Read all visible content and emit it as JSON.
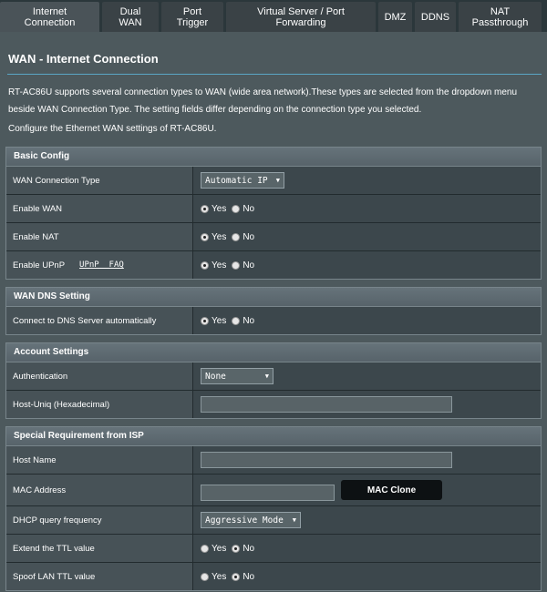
{
  "tabs": [
    {
      "label": "Internet\nConnection",
      "active": true
    },
    {
      "label": "Dual\nWAN",
      "active": false
    },
    {
      "label": "Port\nTrigger",
      "active": false
    },
    {
      "label": "Virtual Server / Port\nForwarding",
      "active": false
    },
    {
      "label": "DMZ",
      "active": false
    },
    {
      "label": "DDNS",
      "active": false
    },
    {
      "label": "NAT\nPassthrough",
      "active": false
    }
  ],
  "page": {
    "title": "WAN - Internet Connection",
    "description": "RT-AC86U supports several connection types to WAN (wide area network).These types are selected from the dropdown menu beside WAN Connection Type. The setting fields differ depending on the connection type you selected.",
    "subdescription": "Configure the Ethernet WAN settings of RT-AC86U."
  },
  "basic": {
    "header": "Basic Config",
    "wan_type_label": "WAN Connection Type",
    "wan_type_value": "Automatic IP",
    "enable_wan_label": "Enable WAN",
    "enable_nat_label": "Enable NAT",
    "enable_upnp_label": "Enable UPnP",
    "upnp_faq": "UPnP  FAQ"
  },
  "dns": {
    "header": "WAN DNS Setting",
    "auto_label": "Connect to DNS Server automatically"
  },
  "account": {
    "header": "Account Settings",
    "auth_label": "Authentication",
    "auth_value": "None",
    "hostuniq_label": "Host-Uniq (Hexadecimal)"
  },
  "isp": {
    "header": "Special Requirement from ISP",
    "hostname_label": "Host Name",
    "mac_label": "MAC Address",
    "mac_clone": "MAC Clone",
    "dhcp_label": "DHCP query frequency",
    "dhcp_value": "Aggressive Mode",
    "ttl_label": "Extend the TTL value",
    "spoof_label": "Spoof LAN TTL value"
  },
  "common": {
    "yes": "Yes",
    "no": "No"
  }
}
